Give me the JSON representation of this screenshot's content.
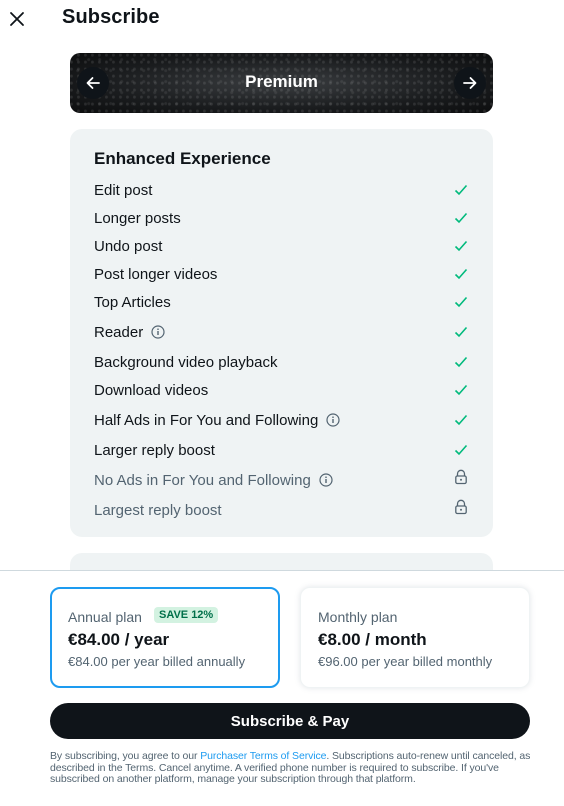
{
  "header": {
    "title": "Subscribe",
    "close_icon": "close-icon"
  },
  "tier_carousel": {
    "tier_name": "Premium",
    "prev_icon": "arrow-left-icon",
    "next_icon": "arrow-right-icon"
  },
  "features": {
    "heading": "Enhanced Experience",
    "items": [
      {
        "label": "Edit post",
        "info": false,
        "status": "check-icon"
      },
      {
        "label": "Longer posts",
        "info": false,
        "status": "check-icon"
      },
      {
        "label": "Undo post",
        "info": false,
        "status": "check-icon"
      },
      {
        "label": "Post longer videos",
        "info": false,
        "status": "check-icon"
      },
      {
        "label": "Top Articles",
        "info": false,
        "status": "check-icon"
      },
      {
        "label": "Reader",
        "info": true,
        "status": "check-icon"
      },
      {
        "label": "Background video playback",
        "info": false,
        "status": "check-icon"
      },
      {
        "label": "Download videos",
        "info": false,
        "status": "check-icon"
      },
      {
        "label": "Half Ads in For You and Following",
        "info": true,
        "status": "check-icon"
      },
      {
        "label": "Larger reply boost",
        "info": false,
        "status": "check-icon"
      },
      {
        "label": "No Ads in For You and Following",
        "info": true,
        "status": "lock-icon"
      },
      {
        "label": "Largest reply boost",
        "info": false,
        "status": "lock-icon"
      }
    ]
  },
  "plans": {
    "annual": {
      "name": "Annual plan",
      "badge": "SAVE 12%",
      "price": "€84.00 / year",
      "billing": "€84.00 per year billed annually",
      "selected": true
    },
    "monthly": {
      "name": "Monthly plan",
      "price": "€8.00 / month",
      "billing": "€96.00 per year billed monthly",
      "selected": false
    }
  },
  "subscribe_button": {
    "label": "Subscribe & Pay"
  },
  "legal": {
    "prefix": "By subscribing, you agree to our ",
    "link": "Purchaser Terms of Service",
    "suffix": ". Subscriptions auto-renew until canceled, as described in the Terms. Cancel anytime. A verified phone number is required to subscribe. If you've subscribed on another platform, manage your subscription through that platform."
  },
  "colors": {
    "accent": "#1d9bf0",
    "check": "#00ba7c",
    "text": "#0f1419",
    "muted": "#536471",
    "card_bg": "#eff3f4",
    "badge_bg": "#d3f2e1",
    "badge_text": "#00704a"
  }
}
